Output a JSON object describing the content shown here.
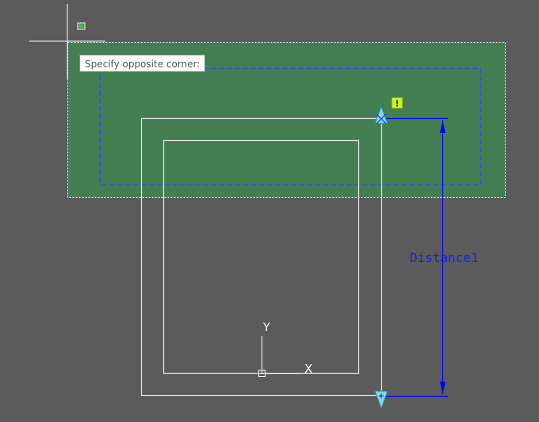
{
  "tooltip": {
    "text": "Specify opposite corner:"
  },
  "dimension": {
    "label": "Distance1"
  },
  "ucs": {
    "x_label": "X",
    "y_label": "Y"
  },
  "grip_warning": {
    "symbol": "!"
  },
  "colors": {
    "background": "#5b5b5b",
    "selection_fill": "#437f53",
    "geometry": "#e8e8e8",
    "dimension": "#0000ff",
    "grip": "#7fd8e6",
    "warning_badge": "#c8f02a"
  }
}
